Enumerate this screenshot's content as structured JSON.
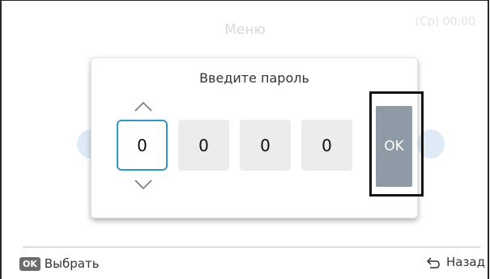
{
  "header": {
    "title": "Меню",
    "time": "(Ср) 00:00"
  },
  "dialog": {
    "title": "Введите пароль",
    "digits": [
      "0",
      "0",
      "0",
      "0"
    ],
    "ok_label": "OK"
  },
  "footer": {
    "select_badge": "OK",
    "select_label": "Выбрать",
    "back_label": "Назад"
  },
  "icons": {
    "up": "chevron-up-icon",
    "down": "chevron-down-icon",
    "back": "back-arrow-icon"
  },
  "colors": {
    "active_border": "#2f97c0",
    "ok_button": "#8e9aa6",
    "digit_bg": "#ececec"
  }
}
